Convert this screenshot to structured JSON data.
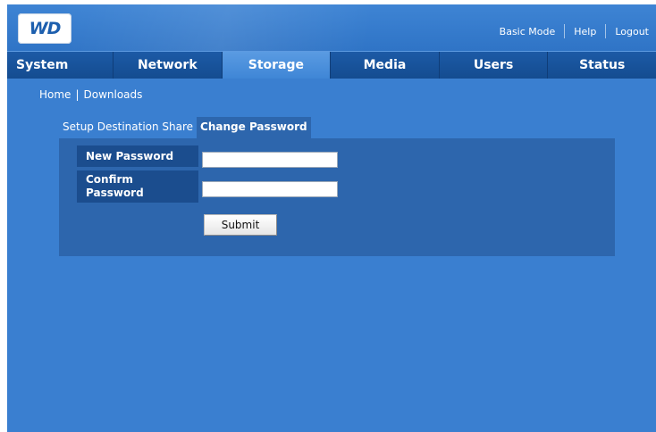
{
  "brand": {
    "logo_text": "WD"
  },
  "top_links": [
    "Basic Mode",
    "Help",
    "Logout"
  ],
  "nav": {
    "tabs": [
      "System",
      "Network",
      "Storage",
      "Media",
      "Users",
      "Status"
    ],
    "active": "Storage"
  },
  "breadcrumb": [
    "Home",
    "Downloads"
  ],
  "subtabs": [
    {
      "label": "Setup Destination Share",
      "active": false
    },
    {
      "label": "Change Password",
      "active": true
    }
  ],
  "form": {
    "new_password_label": "New Password",
    "confirm_password_label_line1": "Confirm",
    "confirm_password_label_line2": "Password",
    "new_password_value": "",
    "confirm_password_value": "",
    "submit_label": "Submit"
  },
  "colors": {
    "page_bg": "#3a7fd0",
    "nav_bg": "#1c5aa6",
    "nav_active": "#4a90dc",
    "panel_bg": "#2d66ad",
    "label_bg": "#1b4d8e"
  }
}
